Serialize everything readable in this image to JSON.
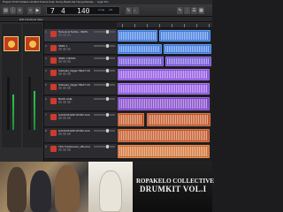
{
  "window": {
    "title": "Project 15 63 Untitled- Hoshimi Freeze Feat. Kenny Beats Fat Young Nobody ... Logic Pro"
  },
  "toolbar": {
    "lcd_bars": "7",
    "lcd_beats": "4",
    "lcd_tempo": "140",
    "lcd_key": "Cmaj",
    "lcd_sig": "4/4"
  },
  "subbar": {
    "label": "Edit Functions View"
  },
  "tracks": [
    {
      "num": "1",
      "name": "Torrens & Torche - SMPL",
      "color": "#3a78e0"
    },
    {
      "num": "2",
      "name": "SMPL 1",
      "color": "#3a78e0"
    },
    {
      "num": "3",
      "name": "SMPL 2 BASS",
      "color": "#6f4fd8"
    },
    {
      "num": "4",
      "name": "Subtraks_Diggin' BEAT 133 BPM",
      "color": "#8a4fe0"
    },
    {
      "num": "5",
      "name": "Subtraks_Diggin' BEAT 133 BPM",
      "color": "#8a4fe0"
    },
    {
      "num": "6",
      "name": "BASS LINE",
      "color": "#7a3ec8"
    },
    {
      "num": "7",
      "name": "GANGSTARR WORK ACAP",
      "color": "#c0501e"
    },
    {
      "num": "8",
      "name": "GANGSTARR WORK ACAP",
      "color": "#c0501e"
    },
    {
      "num": "9",
      "name": "TAG Tracksnotes_uBounce 44k 48k",
      "color": "#d06a2a"
    }
  ],
  "poster": {
    "line1": "ROPAKELO COLLECTIVE",
    "line2": "DRUMKIT VOL.I"
  }
}
